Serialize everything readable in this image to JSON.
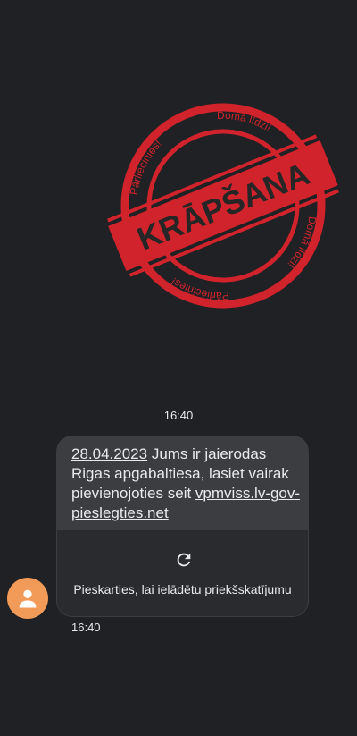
{
  "stamp": {
    "main_text": "KRĀPŠANA",
    "ring_texts": [
      "Pārliecinies!",
      "Domā līdzi!",
      "Domā līdzi!",
      "Pārliecinies!"
    ],
    "color": "#d0232b"
  },
  "conversation": {
    "time_top": "16:40",
    "message": {
      "date_link": "28.04.2023",
      "body": " Jums ir jaierodas Rigas apgabaltiesa, lasiet vairak pievienojoties seit ",
      "url_link": "vpmviss.lv-gov-pieslegties.net"
    },
    "link_preview": {
      "icon": "refresh-icon",
      "text": "Pieskarties, lai ielādētu priekšskatījumu"
    },
    "sender_avatar": "person-icon",
    "time_bottom": "16:40"
  },
  "colors": {
    "background": "#202124",
    "bubble": "#3c3d40",
    "avatar": "#f29a58"
  }
}
